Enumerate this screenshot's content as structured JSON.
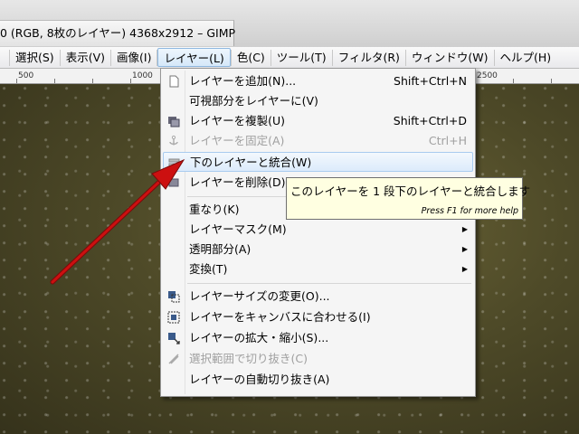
{
  "window": {
    "title": "0 (RGB, 8枚のレイヤー) 4368x2912 – GIMP"
  },
  "menubar": {
    "items": [
      {
        "label": "選択(S)"
      },
      {
        "label": "表示(V)"
      },
      {
        "label": "画像(I)"
      },
      {
        "label": "レイヤー(L)"
      },
      {
        "label": "色(C)"
      },
      {
        "label": "ツール(T)"
      },
      {
        "label": "フィルタ(R)"
      },
      {
        "label": "ウィンドウ(W)"
      },
      {
        "label": "ヘルプ(H)"
      }
    ]
  },
  "ruler": {
    "labels": [
      "500",
      "1000",
      "2500"
    ]
  },
  "layer_menu": {
    "items": [
      {
        "label": "レイヤーを追加(N)...",
        "shortcut": "Shift+Ctrl+N",
        "icon": "new-layer-icon",
        "enabled": true
      },
      {
        "label": "可視部分をレイヤーに(V)",
        "shortcut": "",
        "icon": "",
        "enabled": true
      },
      {
        "label": "レイヤーを複製(U)",
        "shortcut": "Shift+Ctrl+D",
        "icon": "duplicate-layer-icon",
        "enabled": true
      },
      {
        "label": "レイヤーを固定(A)",
        "shortcut": "Ctrl+H",
        "icon": "anchor-icon",
        "enabled": false
      },
      {
        "label": "下のレイヤーと統合(W)",
        "shortcut": "",
        "icon": "merge-down-icon",
        "enabled": true,
        "highlighted": true
      },
      {
        "label": "レイヤーを削除(D)",
        "shortcut": "",
        "icon": "delete-layer-icon",
        "enabled": true
      },
      {
        "label": "重なり(K)",
        "submenu": true,
        "enabled": true
      },
      {
        "label": "レイヤーマスク(M)",
        "submenu": true,
        "enabled": true
      },
      {
        "label": "透明部分(A)",
        "submenu": true,
        "enabled": true
      },
      {
        "label": "変換(T)",
        "submenu": true,
        "enabled": true
      },
      {
        "label": "レイヤーサイズの変更(O)...",
        "icon": "resize-layer-icon",
        "enabled": true
      },
      {
        "label": "レイヤーをキャンバスに合わせる(I)",
        "icon": "layer-to-canvas-icon",
        "enabled": true
      },
      {
        "label": "レイヤーの拡大・縮小(S)...",
        "icon": "scale-layer-icon",
        "enabled": true
      },
      {
        "label": "選択範囲で切り抜き(C)",
        "icon": "crop-icon",
        "enabled": false
      },
      {
        "label": "レイヤーの自動切り抜き(A)",
        "icon": "",
        "enabled": true
      }
    ]
  },
  "tooltip": {
    "text": "このレイヤーを 1 段下のレイヤーと統合します",
    "help": "Press F1 for more help"
  },
  "colors": {
    "highlight": "#dcebfb",
    "tooltip_bg": "#ffffe1",
    "arrow": "#cc1010"
  }
}
